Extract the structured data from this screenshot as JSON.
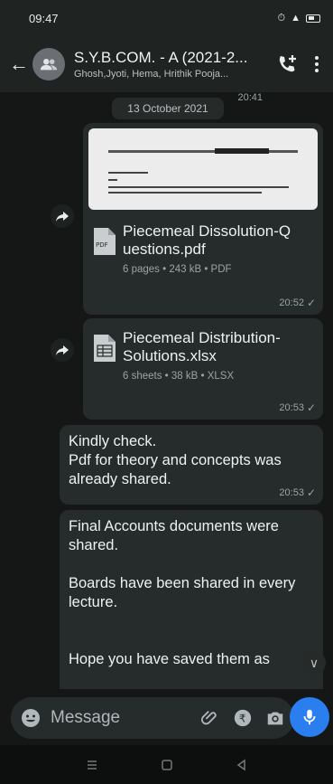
{
  "status_bar": {
    "time": "09:47",
    "icons_text": "⏰ ░ ᴴ⁴ᴳ .∥"
  },
  "app_bar": {
    "title": "S.Y.B.COM. - A (2021-2...",
    "subtitle": "Ghosh,Jyoti, Hema, Hrithik Pooja..."
  },
  "chat": {
    "top_time": "20:41",
    "date_chip": "13 October 2021",
    "messages": [
      {
        "type": "file",
        "file_name": "Piecemeal Dissolution-Q uestions.pdf",
        "meta": "6 pages • 243 kB • PDF",
        "icon_label": "PDF",
        "time": "20:52"
      },
      {
        "type": "file",
        "file_name": "Piecemeal Distribution-Solutions.xlsx",
        "meta": "6 sheets • 38 kB • XLSX",
        "time": "20:53"
      },
      {
        "type": "text",
        "text": "Kindly check.\nPdf for theory and concepts was already shared.",
        "time": "20:53"
      },
      {
        "type": "text",
        "text": "Final Accounts documents were shared.\n\nBoards have been shared in every lecture.\n\n\nHope you have saved them as"
      }
    ]
  },
  "input": {
    "placeholder": "Message"
  },
  "colors": {
    "background": "#141715",
    "bubble": "#262c2b",
    "mic_button": "#2a7ef0"
  }
}
